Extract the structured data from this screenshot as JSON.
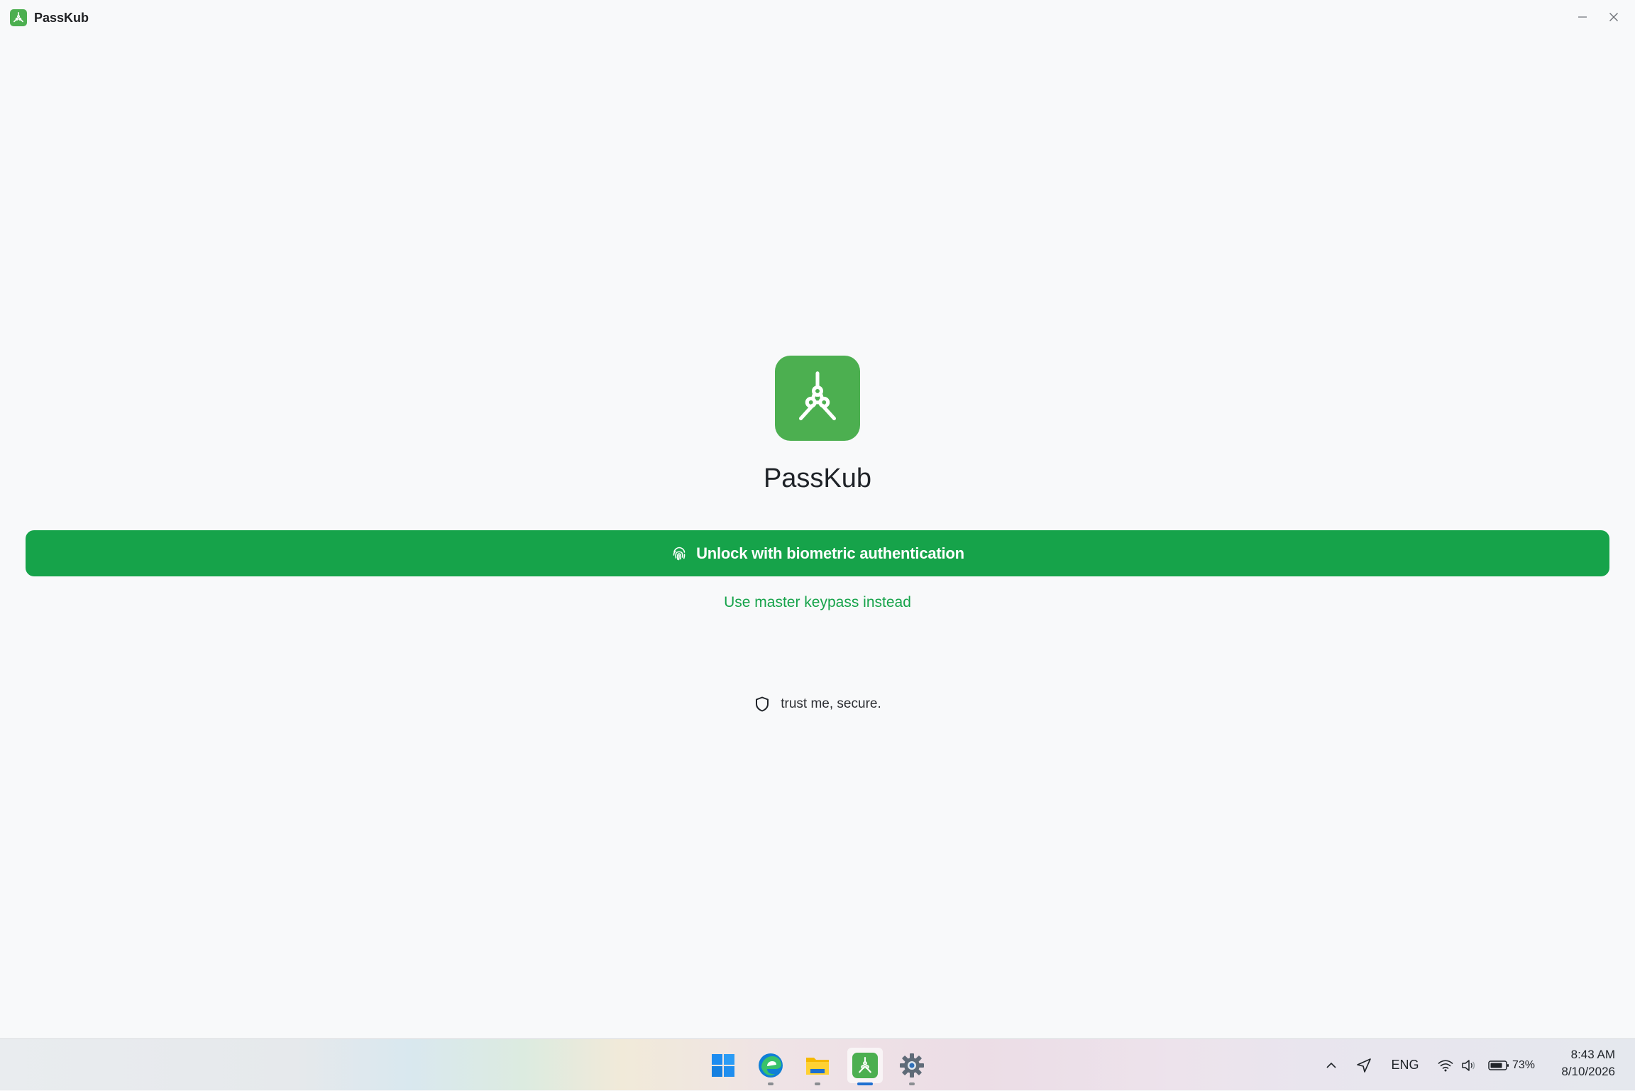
{
  "window": {
    "title": "PassKub",
    "icons": {
      "app": "passkub-logo-icon",
      "minimize": "minimize-icon",
      "close": "close-icon"
    }
  },
  "lock_screen": {
    "app_name": "PassKub",
    "unlock_button_label": "Unlock with biometric authentication",
    "unlock_button_icon": "fingerprint-icon",
    "alt_unlock_link": "Use master keypass instead",
    "secure_note": "trust me, secure.",
    "secure_icon": "shield-icon"
  },
  "taskbar": {
    "apps": [
      {
        "name": "windows-start-icon",
        "running": false
      },
      {
        "name": "edge-browser-icon",
        "running": true
      },
      {
        "name": "file-explorer-icon",
        "running": true
      },
      {
        "name": "passkub-icon",
        "running": true,
        "active": true
      },
      {
        "name": "settings-icon",
        "running": true
      }
    ],
    "tray": {
      "overflow_icon": "chevron-up-icon",
      "location_icon": "location-arrow-icon",
      "language": "ENG",
      "wifi_icon": "wifi-icon",
      "volume_icon": "volume-icon",
      "battery_icon": "battery-icon",
      "battery_percent": "73%"
    },
    "clock": {
      "time": "8:43 AM",
      "date": "8/10/2026"
    }
  },
  "colors": {
    "brand_green": "#4caf50",
    "button_green": "#16a34a",
    "background": "#f8f9fa"
  }
}
